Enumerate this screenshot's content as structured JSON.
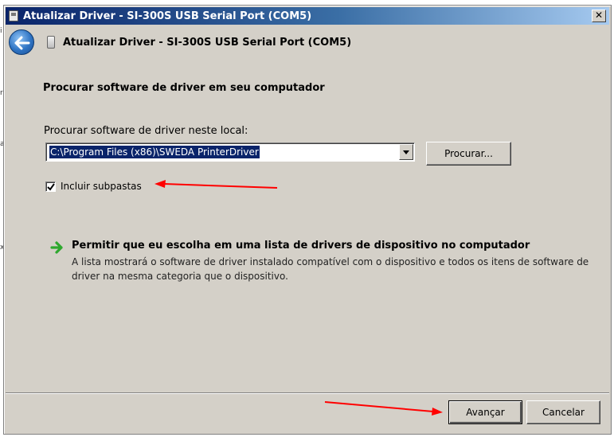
{
  "window": {
    "title": "Atualizar Driver -  SI-300S USB Serial Port (COM5)",
    "close_glyph": "✕"
  },
  "header": {
    "title": "Atualizar Driver -  SI-300S USB Serial Port (COM5)",
    "back_icon": "back-arrow-icon",
    "device_icon": "usb-device-icon"
  },
  "main": {
    "heading": "Procurar software de driver em seu computador",
    "path_label": "Procurar software de driver neste local:",
    "path_value": "C:\\Program Files (x86)\\SWEDA PrinterDriver",
    "browse_label": "Procurar...",
    "include_subfolders": {
      "label": "Incluir subpastas",
      "checked": true
    },
    "option": {
      "title": "Permitir que eu escolha em uma lista de drivers de dispositivo no computador",
      "description": "A lista mostrará o software de driver instalado compatível com o dispositivo e todos os itens de software de driver na mesma categoria que o dispositivo.",
      "icon": "green-arrow-icon"
    }
  },
  "footer": {
    "next_label": "Avançar",
    "cancel_label": "Cancelar"
  },
  "colors": {
    "titlebar": "#0a246a",
    "selection": "#0a246a",
    "annotation_arrow": "#ff0000",
    "option_arrow": "#2ea82e"
  }
}
